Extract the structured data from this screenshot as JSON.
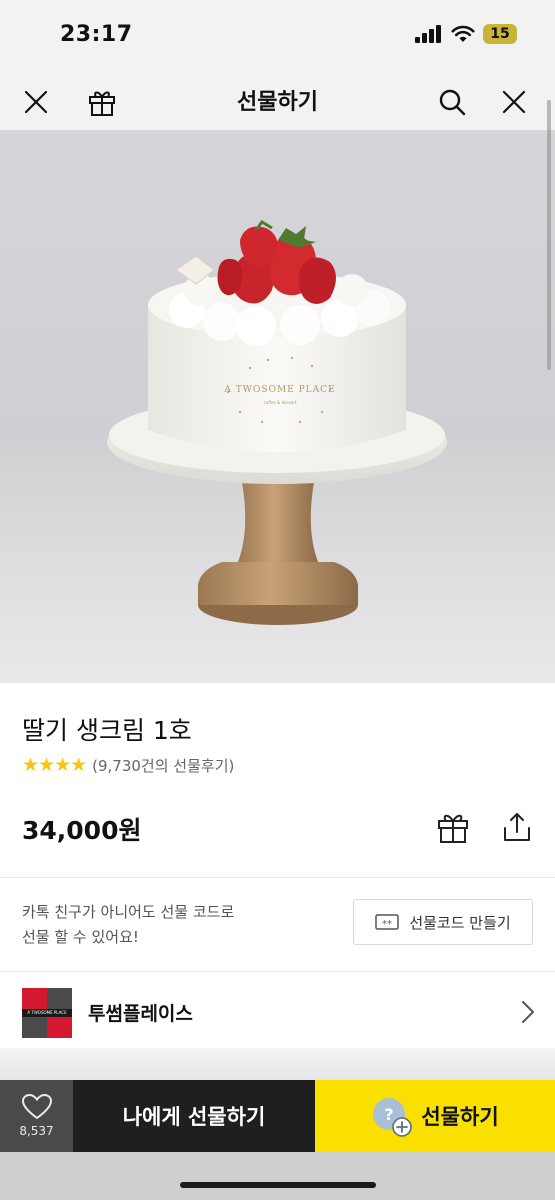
{
  "status_bar": {
    "time": "23:17",
    "battery": "15"
  },
  "nav": {
    "title": "선물하기"
  },
  "hero": {
    "cake_brand_text": "A TWOSOME PLACE",
    "cake_brand_sub": "coffee & dessert"
  },
  "product": {
    "name": "딸기 생크림 1호",
    "stars": "★★★★",
    "review_count": "(9,730건의 선물후기)",
    "price": "34,000원"
  },
  "gift_code": {
    "line1": "카톡 친구가 아니어도 선물 코드로",
    "line2": "선물 할 수 있어요!",
    "button_label": "선물코드 만들기",
    "button_icon_text": "**"
  },
  "brand": {
    "name": "투썸플레이스",
    "logo_text": "A TWOSOME PLACE"
  },
  "bottom_bar": {
    "like_count": "8,537",
    "self_gift_label": "나에게 선물하기",
    "gift_label": "선물하기"
  },
  "colors": {
    "accent_yellow": "#f9e000",
    "star": "#f5c518",
    "dark_button": "#1f1f1f"
  },
  "icons": [
    "close-icon",
    "gift-icon",
    "search-icon",
    "share-icon",
    "heart-icon",
    "chevron-right-icon"
  ]
}
